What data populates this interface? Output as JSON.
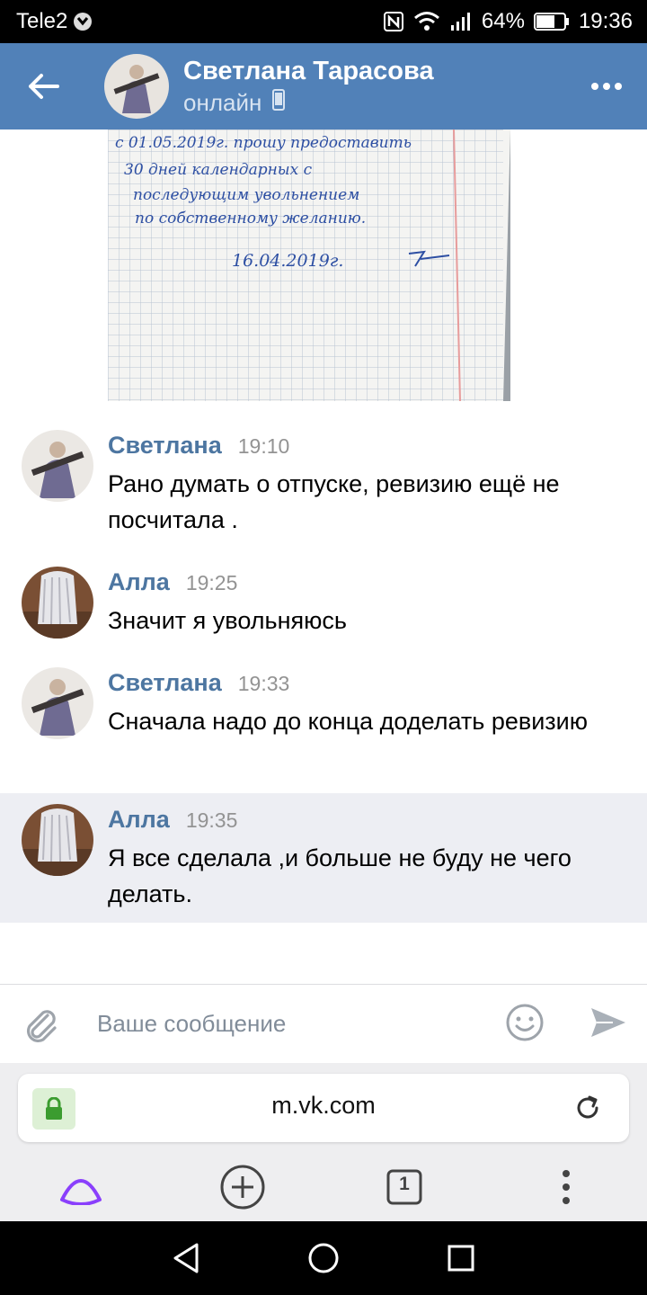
{
  "status_bar": {
    "carrier": "Tele2",
    "battery": "64%",
    "time": "19:36"
  },
  "header": {
    "name": "Светлана Тарасова",
    "status": "онлайн"
  },
  "photo": {
    "lines": [
      "с 01.05.2019г. прошу предоставить",
      "30 дней календарных с",
      "последующим увольнением",
      "по собственному желанию.",
      "16.04.2019г."
    ]
  },
  "messages": [
    {
      "author": "Светлана",
      "time": "19:10",
      "text": "Рано думать о отпуске, ревизию ещё не посчитала ."
    },
    {
      "author": "Алла",
      "time": "19:25",
      "text": "Значит я увольняюсь"
    },
    {
      "author": "Светлана",
      "time": "19:33",
      "text": "Сначала надо до конца доделать ревизию"
    },
    {
      "author": "Алла",
      "time": "19:35",
      "text": "Я все сделала ,и больше не буду не чего делать."
    }
  ],
  "composer": {
    "placeholder": "Ваше сообщение"
  },
  "browser": {
    "url": "m.vk.com",
    "tab_count": "1"
  },
  "colors": {
    "header_bg": "#5181b8",
    "author": "#4d76a1",
    "highlight_bg": "#edeef3",
    "alice": "#8a3ffc"
  }
}
